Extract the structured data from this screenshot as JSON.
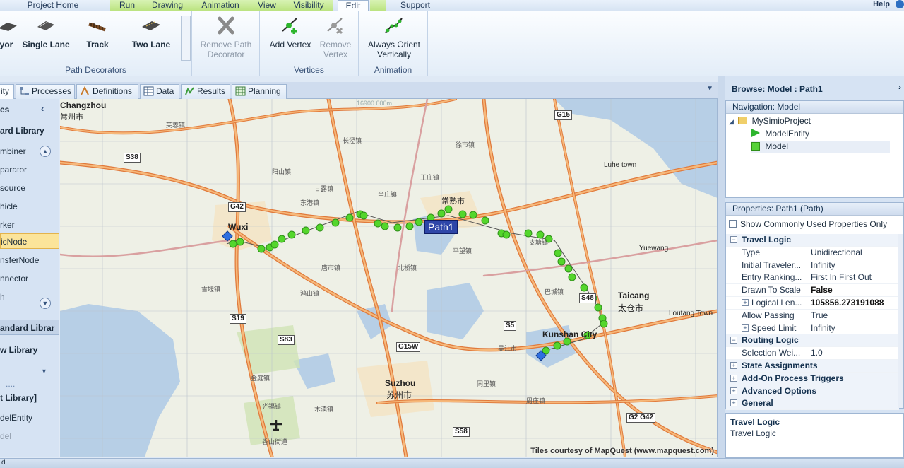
{
  "ribbon_tabs": [
    "Project Home",
    "Run",
    "Drawing",
    "Animation",
    "View",
    "Visibility",
    "Edit",
    "Support"
  ],
  "help_label": "Help",
  "path_decorators": {
    "items": [
      "yor",
      "Single Lane",
      "Track",
      "Two Lane"
    ],
    "remove_label_1": "Remove Path",
    "remove_label_2": "Decorator",
    "group_label": "Path Decorators"
  },
  "vertices": {
    "add_label": "Add Vertex",
    "remove_label_1": "Remove",
    "remove_label_2": "Vertex",
    "group_label": "Vertices"
  },
  "animation": {
    "orient_label_1": "Always Orient",
    "orient_label_2": "Vertically",
    "group_label": "Animation"
  },
  "view_tabs": [
    "ity",
    "Processes",
    "Definitions",
    "Data",
    "Results",
    "Planning"
  ],
  "left_panel": {
    "items": [
      "es",
      "ard Library",
      "mbiner",
      "parator",
      "source",
      "hicle",
      "rker",
      "icNode",
      "nsferNode",
      "nnector",
      "h",
      "andard Librar",
      "w Library",
      "....",
      "t Library]",
      "delEntity",
      "del"
    ]
  },
  "map": {
    "cities": [
      "Changzhou",
      "常州市",
      "Wuxi",
      "Suzhou",
      "苏州市",
      "Kunshan City",
      "Taicang",
      "太仓市",
      "Luhe town",
      "Yuewang",
      "Loutang Town"
    ],
    "towns": [
      "芙蓉镇",
      "雪堰镇",
      "阳山镇",
      "鸿山镇",
      "长泾镇",
      "王庄镇",
      "徐市镇",
      "常熟市",
      "辛庄镇",
      "甘露镇",
      "东港镇",
      "平望镇",
      "支塘镇",
      "巴城镇",
      "北桥镇",
      "周庄镇",
      "吴江市",
      "同里镇",
      "唐市镇",
      "金庭镇",
      "木渎镇",
      "光福镇",
      "香山街道"
    ],
    "shields": [
      "G15",
      "S38",
      "G42",
      "S19",
      "S83",
      "G15W",
      "S5",
      "S48",
      "S58",
      "G2 G42"
    ],
    "path_label": "Path1",
    "scale_text": "16900.000m",
    "credit": "Tiles courtesy of MapQuest (www.mapquest.com)"
  },
  "browse_title": "Browse: Model : Path1",
  "navigation": {
    "header": "Navigation: Model",
    "tree": [
      "MySimioProject",
      "ModelEntity",
      "Model"
    ]
  },
  "properties": {
    "header": "Properties: Path1 (Path)",
    "show_common": "Show Commonly Used Properties Only",
    "rows": [
      {
        "type": "cat",
        "name": "Travel Logic",
        "exp": "−"
      },
      {
        "type": "prop",
        "name": "Type",
        "value": "Unidirectional"
      },
      {
        "type": "prop",
        "name": "Initial Traveler...",
        "value": "Infinity"
      },
      {
        "type": "prop",
        "name": "Entry Ranking...",
        "value": "First In First Out"
      },
      {
        "type": "prop",
        "name": "Drawn To Scale",
        "value": "False",
        "bold": true
      },
      {
        "type": "prop",
        "name": "Logical Len...",
        "value": "105856.273191088",
        "bold": true,
        "exp": "+"
      },
      {
        "type": "prop",
        "name": "Allow Passing",
        "value": "True"
      },
      {
        "type": "prop",
        "name": "Speed Limit",
        "value": "Infinity",
        "exp": "+"
      },
      {
        "type": "cat",
        "name": "Routing Logic",
        "exp": "−"
      },
      {
        "type": "prop",
        "name": "Selection Wei...",
        "value": "1.0"
      },
      {
        "type": "cat",
        "name": "State Assignments",
        "exp": "+"
      },
      {
        "type": "cat",
        "name": "Add-On Process Triggers",
        "exp": "+"
      },
      {
        "type": "cat",
        "name": "Advanced Options",
        "exp": "+"
      },
      {
        "type": "cat",
        "name": "General",
        "exp": "+"
      }
    ]
  },
  "description": {
    "title": "Travel Logic",
    "text": "Travel Logic"
  },
  "status": "d"
}
